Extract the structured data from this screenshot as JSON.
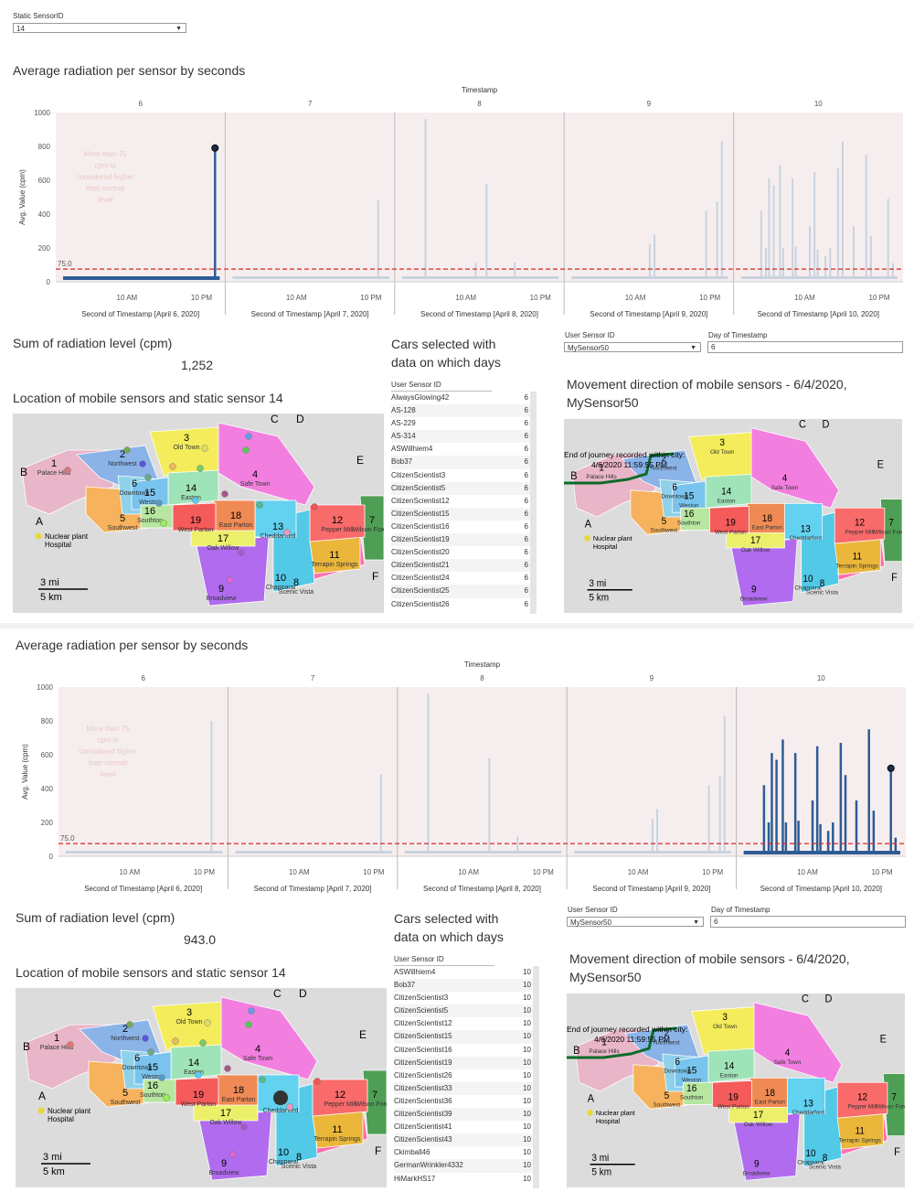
{
  "static_filter": {
    "label": "Static SensorID",
    "value": "14"
  },
  "dashboards": [
    {
      "chart_title": "Average radiation per sensor by seconds",
      "chart_data": {
        "type": "line",
        "column_header": "Timestamp",
        "columns": [
          "6",
          "7",
          "8",
          "9",
          "10"
        ],
        "ylabel": "Avg. Value (cpm)",
        "y_ticks": [
          "1000",
          "800",
          "600",
          "400",
          "200",
          "0"
        ],
        "ylim": [
          0,
          1000
        ],
        "reference_line": {
          "value": 75.0,
          "label": "75.0"
        },
        "annotation": "More than 75 cpm is considered higher than normal level",
        "x_ticks": [
          "10 AM",
          "10 PM"
        ],
        "x_labels": [
          "Second of Timestamp [April 6, 2020]",
          "Second of Timestamp [April 7, 2020]",
          "Second of Timestamp [April 8, 2020]",
          "Second of Timestamp [April 9, 2020]",
          "Second of Timestamp [April 10, 2020]"
        ],
        "highlighted_column": 0,
        "spikes": [
          [
            {
              "t": 0.97,
              "v": 790
            }
          ],
          [
            {
              "t": 0.93,
              "v": 485
            }
          ],
          [
            {
              "t": 0.15,
              "v": 960
            },
            {
              "t": 0.54,
              "v": 580
            },
            {
              "t": 0.47,
              "v": 110
            },
            {
              "t": 0.72,
              "v": 115
            }
          ],
          [
            {
              "t": 0.5,
              "v": 220
            },
            {
              "t": 0.53,
              "v": 280
            },
            {
              "t": 0.86,
              "v": 420
            },
            {
              "t": 0.93,
              "v": 475
            },
            {
              "t": 0.96,
              "v": 830
            }
          ],
          [
            {
              "t": 0.13,
              "v": 420
            },
            {
              "t": 0.16,
              "v": 200
            },
            {
              "t": 0.18,
              "v": 610
            },
            {
              "t": 0.21,
              "v": 570
            },
            {
              "t": 0.25,
              "v": 690
            },
            {
              "t": 0.27,
              "v": 200
            },
            {
              "t": 0.33,
              "v": 610
            },
            {
              "t": 0.35,
              "v": 210
            },
            {
              "t": 0.44,
              "v": 330
            },
            {
              "t": 0.47,
              "v": 650
            },
            {
              "t": 0.49,
              "v": 190
            },
            {
              "t": 0.54,
              "v": 150
            },
            {
              "t": 0.57,
              "v": 200
            },
            {
              "t": 0.62,
              "v": 670
            },
            {
              "t": 0.65,
              "v": 830
            },
            {
              "t": 0.72,
              "v": 330
            },
            {
              "t": 0.8,
              "v": 750
            },
            {
              "t": 0.83,
              "v": 270
            },
            {
              "t": 0.94,
              "v": 490
            },
            {
              "t": 0.97,
              "v": 110
            }
          ]
        ]
      },
      "sum_title": "Sum of radiation level (cpm)",
      "sum_value": "1,252",
      "cars_title_1": "Cars selected with",
      "cars_title_2": "data on which days",
      "list_header": "User Sensor ID",
      "list": [
        {
          "id": "AlwaysGlowing42",
          "days": "6"
        },
        {
          "id": "AS-128",
          "days": "6"
        },
        {
          "id": "AS-229",
          "days": "6"
        },
        {
          "id": "AS-314",
          "days": "6"
        },
        {
          "id": "ASWillhiem4",
          "days": "6"
        },
        {
          "id": "Bob37",
          "days": "6"
        },
        {
          "id": "CitizenScientist3",
          "days": "6"
        },
        {
          "id": "CitizenScientist5",
          "days": "6"
        },
        {
          "id": "CitizenScientist12",
          "days": "6"
        },
        {
          "id": "CitizenScientist15",
          "days": "6"
        },
        {
          "id": "CitizenScientist16",
          "days": "6"
        },
        {
          "id": "CitizenScientist19",
          "days": "6"
        },
        {
          "id": "CitizenScientist20",
          "days": "6"
        },
        {
          "id": "CitizenScientist21",
          "days": "6"
        },
        {
          "id": "CitizenScientist24",
          "days": "6"
        },
        {
          "id": "CitizenScientist25",
          "days": "6"
        },
        {
          "id": "CitizenScientist26",
          "days": "6"
        }
      ],
      "user_sensor_label": "User Sensor ID",
      "user_sensor_value": "MySensor50",
      "day_label": "Day of Timestamp",
      "day_value": "6",
      "location_title": "Location of mobile sensors and static sensor 14",
      "movement_title_1": "Movement direction of mobile sensors - 6/4/2020,",
      "movement_title_2": "MySensor50",
      "end_journey_1": "End of journey recorded within city:",
      "end_journey_2": "4/6/2020 11:59:55 PM"
    },
    {
      "chart_title": "Average radiation per sensor by seconds",
      "chart_data": {
        "type": "line",
        "column_header": "Timestamp",
        "columns": [
          "6",
          "7",
          "8",
          "9",
          "10"
        ],
        "ylabel": "Avg. Value (cpm)",
        "y_ticks": [
          "1000",
          "800",
          "600",
          "400",
          "200",
          "0"
        ],
        "ylim": [
          0,
          1000
        ],
        "reference_line": {
          "value": 75.0,
          "label": "75.0"
        },
        "annotation": "More than 75 cpm is considered higher than normal level",
        "x_ticks": [
          "10 AM",
          "10 PM"
        ],
        "x_labels": [
          "Second of Timestamp [April 6, 2020]",
          "Second of Timestamp [April 7, 2020]",
          "Second of Timestamp [April 8, 2020]",
          "Second of Timestamp [April 9, 2020]",
          "Second of Timestamp [April 10, 2020]"
        ],
        "highlighted_column": 4,
        "spikes": [
          [
            {
              "t": 0.93,
              "v": 800
            }
          ],
          [
            {
              "t": 0.93,
              "v": 485
            }
          ],
          [
            {
              "t": 0.15,
              "v": 960
            },
            {
              "t": 0.54,
              "v": 580
            },
            {
              "t": 0.72,
              "v": 115
            }
          ],
          [
            {
              "t": 0.5,
              "v": 220
            },
            {
              "t": 0.53,
              "v": 280
            },
            {
              "t": 0.86,
              "v": 420
            },
            {
              "t": 0.93,
              "v": 475
            },
            {
              "t": 0.96,
              "v": 830
            }
          ],
          [
            {
              "t": 0.13,
              "v": 420
            },
            {
              "t": 0.16,
              "v": 200
            },
            {
              "t": 0.18,
              "v": 610
            },
            {
              "t": 0.21,
              "v": 570
            },
            {
              "t": 0.25,
              "v": 690
            },
            {
              "t": 0.27,
              "v": 200
            },
            {
              "t": 0.33,
              "v": 610
            },
            {
              "t": 0.35,
              "v": 210
            },
            {
              "t": 0.44,
              "v": 330
            },
            {
              "t": 0.47,
              "v": 650
            },
            {
              "t": 0.49,
              "v": 190
            },
            {
              "t": 0.54,
              "v": 150
            },
            {
              "t": 0.57,
              "v": 200
            },
            {
              "t": 0.62,
              "v": 670
            },
            {
              "t": 0.65,
              "v": 480
            },
            {
              "t": 0.72,
              "v": 330
            },
            {
              "t": 0.8,
              "v": 750
            },
            {
              "t": 0.83,
              "v": 270
            },
            {
              "t": 0.94,
              "v": 520
            },
            {
              "t": 0.97,
              "v": 110
            }
          ]
        ]
      },
      "sum_title": "Sum of radiation level (cpm)",
      "sum_value": "943.0",
      "cars_title_1": "Cars selected with",
      "cars_title_2": "data on which days",
      "list_header": "User Sensor ID",
      "list": [
        {
          "id": "ASWillhiem4",
          "days": "10"
        },
        {
          "id": "Bob37",
          "days": "10"
        },
        {
          "id": "CitizenScientist3",
          "days": "10"
        },
        {
          "id": "CitizenScientist5",
          "days": "10"
        },
        {
          "id": "CitizenScientist12",
          "days": "10"
        },
        {
          "id": "CitizenScientist15",
          "days": "10"
        },
        {
          "id": "CitizenScientist16",
          "days": "10"
        },
        {
          "id": "CitizenScientist19",
          "days": "10"
        },
        {
          "id": "CitizenScientist26",
          "days": "10"
        },
        {
          "id": "CitizenScientist33",
          "days": "10"
        },
        {
          "id": "CitizenScientist36",
          "days": "10"
        },
        {
          "id": "CitizenScientist39",
          "days": "10"
        },
        {
          "id": "CitizenScientist41",
          "days": "10"
        },
        {
          "id": "CitizenScientist43",
          "days": "10"
        },
        {
          "id": "Ckimball46",
          "days": "10"
        },
        {
          "id": "GermanWrinkler4332",
          "days": "10"
        },
        {
          "id": "HiMarkHS17",
          "days": "10"
        }
      ],
      "user_sensor_label": "User Sensor ID",
      "user_sensor_value": "MySensor50",
      "day_label": "Day of Timestamp",
      "day_value": "6",
      "location_title": "Location of mobile sensors and static sensor 14",
      "movement_title_1": "Movement direction of mobile sensors - 6/4/2020,",
      "movement_title_2": "MySensor50",
      "end_journey_1": "End of journey recorded within city:",
      "end_journey_2": "4/6/2020 11:59:55 PM"
    }
  ],
  "map_labels": {
    "regions": [
      {
        "num": "1",
        "name": "Palace Hills"
      },
      {
        "num": "2",
        "name": "Northwest"
      },
      {
        "num": "3",
        "name": "Old Town"
      },
      {
        "num": "4",
        "name": "Safe Town"
      },
      {
        "num": "5",
        "name": "Southwest"
      },
      {
        "num": "6",
        "name": "Downtown"
      },
      {
        "num": "7",
        "name": "Wilson Forest"
      },
      {
        "num": "8",
        "name": "Scenic Vista"
      },
      {
        "num": "9",
        "name": "Broadview"
      },
      {
        "num": "10",
        "name": "Chapparal"
      },
      {
        "num": "11",
        "name": "Terrapin Springs"
      },
      {
        "num": "12",
        "name": "Pepper Mill"
      },
      {
        "num": "13",
        "name": "Cheddarford"
      },
      {
        "num": "14",
        "name": "Easton"
      },
      {
        "num": "15",
        "name": "Weston"
      },
      {
        "num": "16",
        "name": "Southton"
      },
      {
        "num": "17",
        "name": "Oak Willow"
      },
      {
        "num": "18",
        "name": "East Parton"
      },
      {
        "num": "19",
        "name": "West Parton"
      }
    ],
    "letters": [
      "A",
      "B",
      "C",
      "D",
      "E",
      "F"
    ],
    "legend_plant": "Nuclear plant",
    "legend_hospital": "Hospital",
    "scale_mi": "3 mi",
    "scale_km": "5 km"
  },
  "colors": {
    "highlight": "#2e5c95",
    "faded": "#c8d3df",
    "refline": "#d62728",
    "band": "#f6eeee"
  }
}
